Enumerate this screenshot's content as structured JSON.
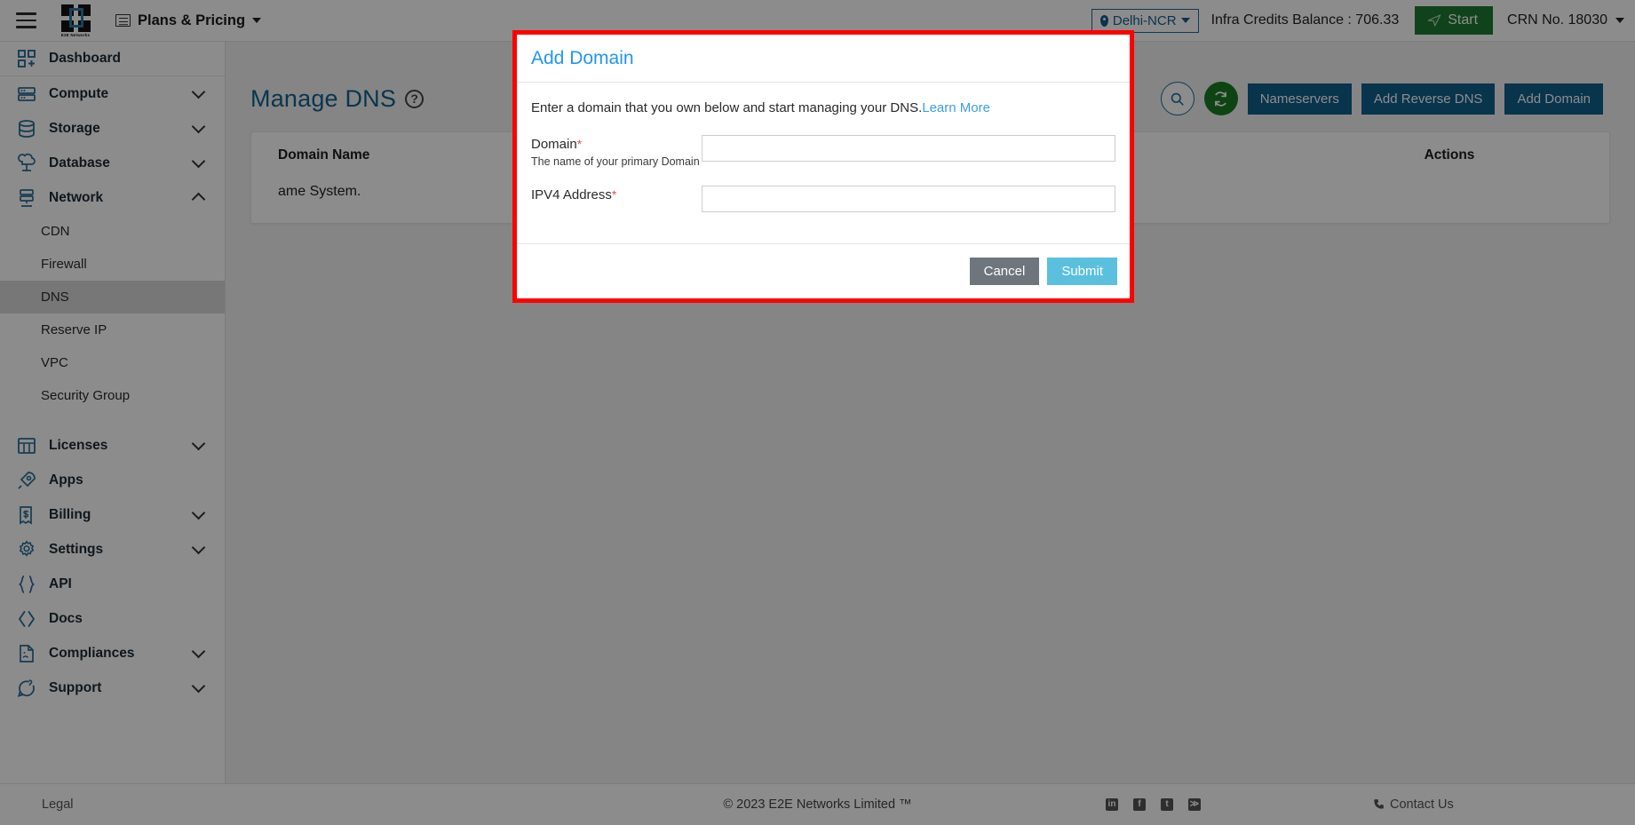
{
  "topbar": {
    "menu_icon": "hamburger-icon",
    "logo_text": "E2E Networks",
    "plans_label": "Plans & Pricing",
    "region_label": "Delhi-NCR",
    "credits_label": "Infra Credits Balance : 706.33",
    "start_label": "Start",
    "crn_label": "CRN No. 18030"
  },
  "sidebar": {
    "items": [
      {
        "label": "Dashboard",
        "icon": "dashboard-icon",
        "expandable": false
      },
      {
        "label": "Compute",
        "icon": "compute-icon",
        "expandable": true,
        "expanded": false
      },
      {
        "label": "Storage",
        "icon": "storage-icon",
        "expandable": true,
        "expanded": false
      },
      {
        "label": "Database",
        "icon": "database-icon",
        "expandable": true,
        "expanded": false
      },
      {
        "label": "Network",
        "icon": "network-icon",
        "expandable": true,
        "expanded": true
      },
      {
        "label": "Licenses",
        "icon": "licenses-icon",
        "expandable": true,
        "expanded": false
      },
      {
        "label": "Apps",
        "icon": "apps-rocket-icon",
        "expandable": false
      },
      {
        "label": "Billing",
        "icon": "billing-icon",
        "expandable": true,
        "expanded": false
      },
      {
        "label": "Settings",
        "icon": "gear-icon",
        "expandable": true,
        "expanded": false
      },
      {
        "label": "API",
        "icon": "api-braces-icon",
        "expandable": false
      },
      {
        "label": "Docs",
        "icon": "docs-code-icon",
        "expandable": false
      },
      {
        "label": "Compliances",
        "icon": "compliances-doc-icon",
        "expandable": true,
        "expanded": false
      },
      {
        "label": "Support",
        "icon": "support-chat-icon",
        "expandable": true,
        "expanded": false
      }
    ],
    "network_children": [
      {
        "label": "CDN",
        "active": false
      },
      {
        "label": "Firewall",
        "active": false
      },
      {
        "label": "DNS",
        "active": true
      },
      {
        "label": "Reserve IP",
        "active": false
      },
      {
        "label": "VPC",
        "active": false
      },
      {
        "label": "Security Group",
        "active": false
      }
    ]
  },
  "main": {
    "page_title": "Manage DNS",
    "help_glyph": "?",
    "actions": {
      "search_icon": "search-icon",
      "refresh_icon": "refresh-icon",
      "nameservers_label": "Nameservers",
      "add_reverse_dns_label": "Add Reverse DNS",
      "add_domain_label": "Add Domain"
    },
    "table": {
      "columns": [
        "Domain Name",
        "Actions"
      ],
      "empty_text": "ame System."
    }
  },
  "modal": {
    "title": "Add Domain",
    "description": "Enter a domain that you own below and start managing your DNS.",
    "learn_more_label": "Learn More",
    "fields": [
      {
        "label": "Domain",
        "required_mark": "*",
        "help": "The name of your primary Domain",
        "value": "",
        "placeholder": ""
      },
      {
        "label": "IPV4 Address",
        "required_mark": "*",
        "help": "",
        "value": "",
        "placeholder": ""
      }
    ],
    "cancel_label": "Cancel",
    "submit_label": "Submit",
    "highlight_color": "#fe0000",
    "title_color": "#2196f3",
    "submit_color": "#5bc0de",
    "cancel_color": "#6e757c"
  },
  "footer": {
    "legal_label": "Legal",
    "copyright": "© 2023 E2E Networks Limited ™",
    "social": [
      {
        "name": "linkedin-icon",
        "glyph": "in"
      },
      {
        "name": "facebook-icon",
        "glyph": "f"
      },
      {
        "name": "twitter-icon",
        "glyph": "t"
      },
      {
        "name": "rss-icon",
        "glyph": "≫"
      }
    ],
    "contact_label": "Contact Us"
  }
}
